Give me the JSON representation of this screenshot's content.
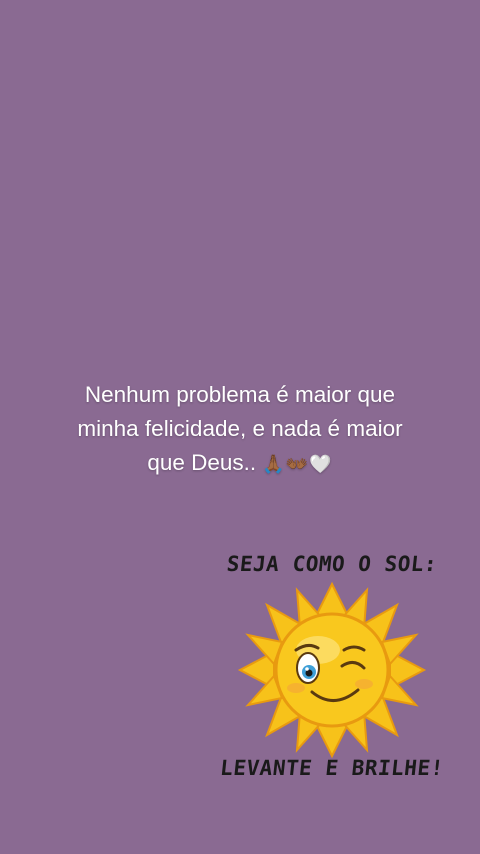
{
  "post": {
    "caption_lines": [
      "Nenhum problema é maior que",
      "minha felicidade, e nada é maior",
      "que Deus.."
    ],
    "caption_emojis": "🙏🏾👐🏾🤍"
  },
  "sticker": {
    "top_text": "SEJA COMO O SOL:",
    "bottom_text": "LEVANTE E BRILHE!"
  },
  "colors": {
    "background": "#8a6a92",
    "sun": "#f7c21a",
    "sun_shadow": "#e89a10"
  }
}
